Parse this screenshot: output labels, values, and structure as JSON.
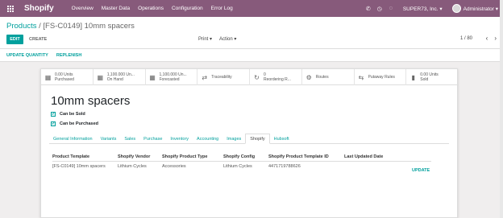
{
  "topbar": {
    "brand": "Shopify",
    "menu": [
      "Overview",
      "Master Data",
      "Operations",
      "Configuration",
      "Error Log"
    ],
    "company": "SUPER73, Inc. ▾",
    "user": "Administrator ▾",
    "icons": [
      "phone-icon",
      "clock-icon",
      "chat-icon"
    ]
  },
  "control": {
    "breadcrumb_parent": "Products",
    "breadcrumb_sep": " / ",
    "breadcrumb_current": "[FS-C0149] 10mm spacers",
    "edit": "EDIT",
    "create": "CREATE",
    "print": "Print ▾",
    "action": "Action ▾",
    "pager": "1 / 80",
    "prev": "‹",
    "next": "›"
  },
  "statusbar": {
    "update_quantity": "UPDATE QUANTITY",
    "replenish": "REPLENISH"
  },
  "stats": [
    {
      "icon": "cubes-icon",
      "glyph": "▦",
      "line1": "0.00 Units",
      "line2": "Purchased"
    },
    {
      "icon": "cubes-icon",
      "glyph": "▦",
      "line1": "1,100.000 Un...",
      "line2": "On Hand"
    },
    {
      "icon": "cubes-icon",
      "glyph": "▦",
      "line1": "1,100.000 Un...",
      "line2": "Forecasted"
    },
    {
      "icon": "arrows-icon",
      "glyph": "⇄",
      "line1": "Traceability",
      "line2": ""
    },
    {
      "icon": "refresh-icon",
      "glyph": "↻",
      "line1": "0",
      "line2": "Reordering R..."
    },
    {
      "icon": "cogs-icon",
      "glyph": "⚙",
      "line1": "Routes",
      "line2": ""
    },
    {
      "icon": "random-icon",
      "glyph": "⇆",
      "line1": "Putaway Rules",
      "line2": ""
    },
    {
      "icon": "chart-icon",
      "glyph": "▮",
      "line1": "0.00 Units",
      "line2": "Sold"
    }
  ],
  "product": {
    "name": "10mm spacers",
    "can_be_sold": "Can be Sold",
    "can_be_purchased": "Can be Purchased",
    "check": "✓"
  },
  "tabs": [
    "General Information",
    "Variants",
    "Sales",
    "Purchase",
    "Inventory",
    "Accounting",
    "Images",
    "Shopify",
    "Hubsoft"
  ],
  "active_tab": "Shopify",
  "table": {
    "headers": [
      "Product Template",
      "Shopify Vendor",
      "Shopify Product Type",
      "Shopify Config",
      "Shopify Product Template ID",
      "Last Updated Date"
    ],
    "row": [
      "[FS-C0149] 10mm spacers",
      "Lithium Cycles",
      "Accessories",
      "Lithium Cycles",
      "4471719788626",
      ""
    ],
    "update": "UPDATE"
  }
}
